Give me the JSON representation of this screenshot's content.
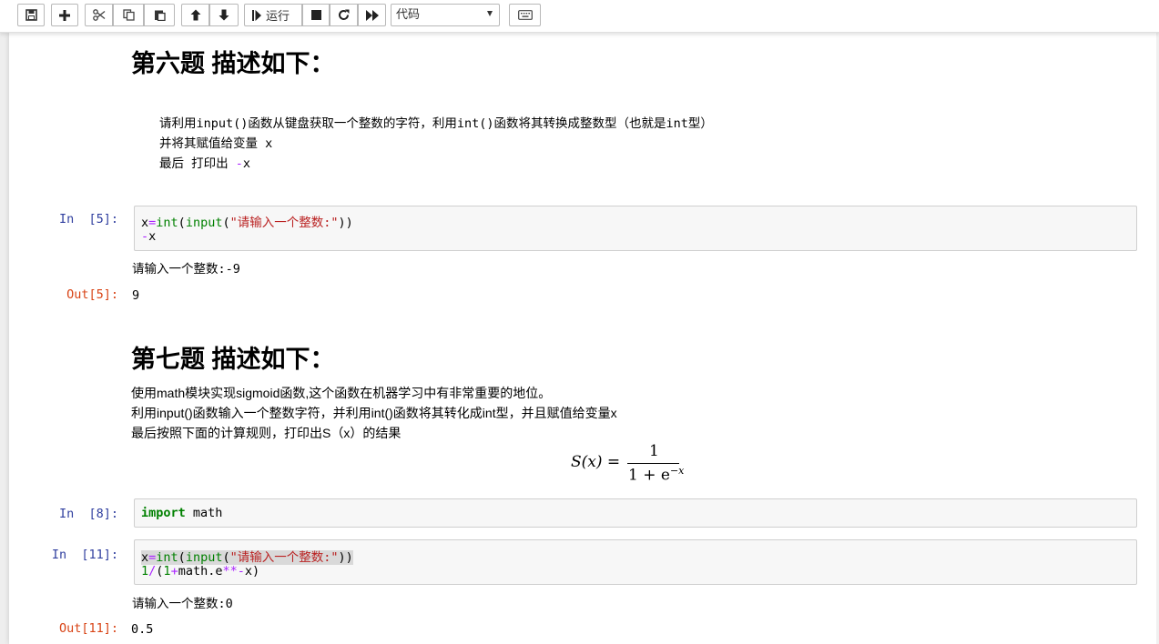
{
  "toolbar": {
    "run_label": "运行",
    "cell_type_value": "代码",
    "buttons": [
      "save-icon",
      "plus-icon",
      "cut-icon",
      "copy-icon",
      "paste-icon",
      "arrow-up-icon",
      "arrow-down-icon",
      "run-icon",
      "stop-icon",
      "restart-icon",
      "fast-forward-icon",
      "keyboard-icon"
    ]
  },
  "cells": {
    "q6": {
      "heading": "第六题 描述如下：",
      "lines": [
        "请利用input()函数从键盘获取一个整数的字符，利用int()函数将其转换成整数型（也就是int型）",
        "并将其赋值给变量 x",
        "最后 打印出 "
      ],
      "line3_op": "-",
      "line3_var": "x"
    },
    "in5": {
      "prompt": "In  [5]:",
      "code": {
        "l1_var": "x",
        "l1_eq": "=",
        "l1_int": "int",
        "l1_p1": "(",
        "l1_input": "input",
        "l1_p2": "(",
        "l1_str": "\"请输入一个整数:\"",
        "l1_p3": "))",
        "l2_op": "-",
        "l2_var": "x"
      },
      "stdout": "请输入一个整数:-9",
      "out_prompt": "Out[5]:",
      "output": "9"
    },
    "q7": {
      "heading": "第七题 描述如下：",
      "lines": [
        "使用math模块实现sigmoid函数,这个函数在机器学习中有非常重要的地位。",
        "利用input()函数输入一个整数字符，并利用int()函数将其转化成int型，并且赋值给变量x",
        "最后按照下面的计算规则，打印出S（x）的结果"
      ],
      "formula": {
        "lhs": "S(x) =",
        "numerator": "1",
        "denominator": "1 + e",
        "exponent": "−x"
      }
    },
    "in8": {
      "prompt": "In  [8]:",
      "code": {
        "kw": "import",
        "rest": " math"
      }
    },
    "in11": {
      "prompt": "In  [11]:",
      "code": {
        "l1_var": "x",
        "l1_eq": "=",
        "l1_int": "int",
        "l1_p1": "(",
        "l1_input": "input",
        "l1_p2": "(",
        "l1_str": "\"请输入一个整数:\"",
        "l1_p3": "))",
        "l2_num": "1",
        "l2_div": "/",
        "l2_p": "(",
        "l2_one": "1",
        "l2_plus": "+",
        "l2_math": "math",
        "l2_e": ".e",
        "l2_pow": "**",
        "l2_neg": "-",
        "l2_tail": "x)"
      },
      "stdout": "请输入一个整数:0",
      "out_prompt": "Out[11]:",
      "output": "0.5"
    }
  }
}
